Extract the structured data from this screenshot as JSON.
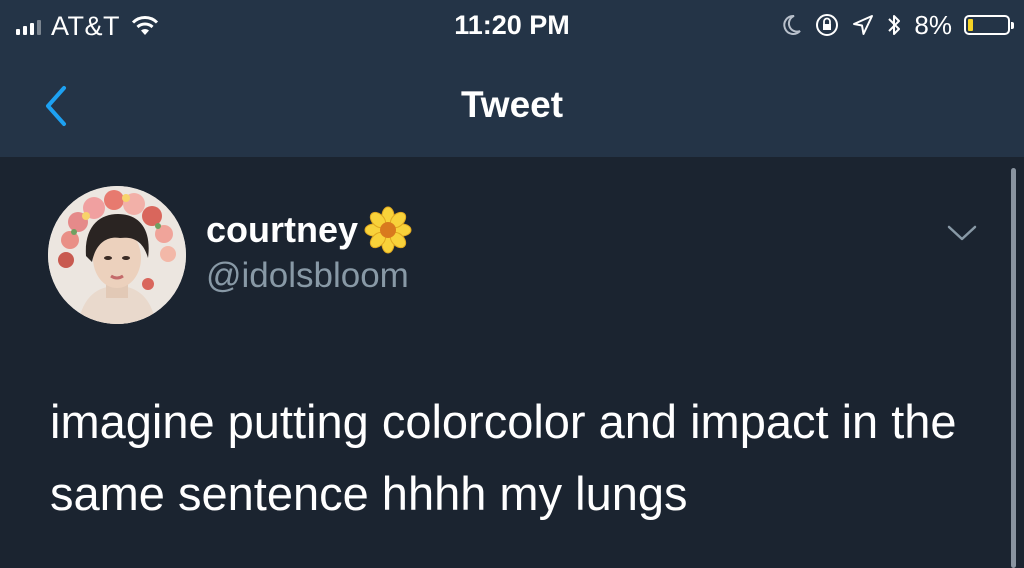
{
  "status_bar": {
    "carrier": "AT&T",
    "time": "11:20 PM",
    "battery_percent": "8%",
    "battery_level": 0.08,
    "icons": [
      "signal-icon",
      "wifi-icon",
      "moon-icon",
      "orientation-lock-icon",
      "location-icon",
      "bluetooth-icon",
      "battery-icon"
    ]
  },
  "nav": {
    "title": "Tweet",
    "back_icon": "chevron-left-icon"
  },
  "tweet": {
    "author": {
      "display_name": "courtney",
      "emoji": "🌼",
      "handle": "@idolsbloom"
    },
    "text": "imagine putting colorcolor and impact in the same sentence hhhh my lungs",
    "menu_icon": "chevron-down-icon"
  },
  "colors": {
    "nav_background": "#243447",
    "content_background": "#1b2430",
    "accent": "#1da1f2",
    "secondary_text": "#8899a6"
  }
}
